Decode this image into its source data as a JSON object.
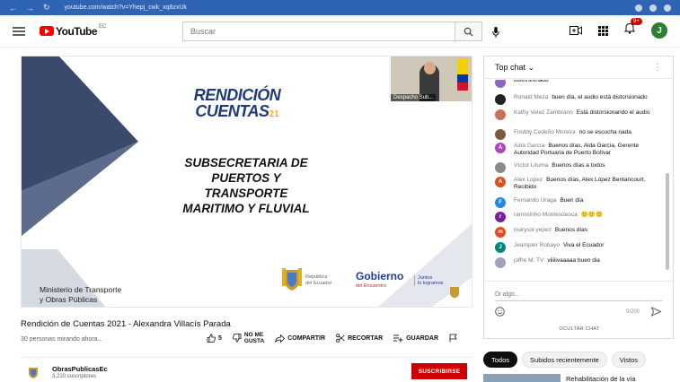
{
  "browser": {
    "url": "youtube.com/watch?v=Yhepj_cwk_xq8zxUk"
  },
  "header": {
    "logo_text": "YouTube",
    "country": "EC",
    "search_placeholder": "Buscar",
    "notification_count": "9+",
    "avatar_letter": "J",
    "colors": {
      "logo_red": "#ff0000",
      "avatar_bg": "#2e7d32"
    }
  },
  "video": {
    "rendicion_top": "RENDICIÓN",
    "rendicion_bottom": "CUENTAS",
    "rendicion_year": "21",
    "subtitle_lines": [
      "SUBSECRETARIA DE",
      "PUERTOS Y",
      "TRANSPORTE",
      "MARITIMO Y FLUVIAL"
    ],
    "ministerio_lines": [
      "Ministerio de Transporte",
      "y Obras Públicas"
    ],
    "pip_label": "Despacho Sub...",
    "republica_lines": [
      "República",
      "del Ecuador"
    ],
    "gobierno": "Gobierno",
    "gobierno_sub": "del Encuentro",
    "juntos_lines": [
      "Juntos",
      "lo logramos"
    ]
  },
  "below": {
    "title": "Rendición de Cuentas 2021 - Alexandra Villacís Parada",
    "viewers": "30 personas mirando ahora...",
    "like_count": "5",
    "dislike_label_1": "NO ME",
    "dislike_label_2": "GUSTA",
    "share_label": "COMPARTIR",
    "clip_label": "RECORTAR",
    "save_label": "GUARDAR"
  },
  "channel": {
    "name": "ObrasPublicasEc",
    "subscribers": "3,210 suscriptores",
    "subscribe_label": "SUSCRIBIRSE"
  },
  "chat": {
    "title": "Top chat",
    "messages": [
      {
        "author": "",
        "text": "distorsionado",
        "color": "#8e63c9",
        "initial": ""
      },
      {
        "author": "Ronald Meza",
        "text": "buen día, el audio está distorsionado",
        "color": "#222222",
        "initial": ""
      },
      {
        "author": "Kathy Velez Zambrano",
        "text": "Está distorsionando el audio",
        "color": "#c8705a",
        "initial": ""
      },
      {
        "author": "Freddy Cedeño Moreira",
        "text": "no se escucha nada",
        "color": "#7a5a3a",
        "initial": ""
      },
      {
        "author": "Aida García",
        "text": "Buenos días, Aida García, Gerente Autoridad Portuaria de Puerto Bolívar",
        "color": "#ab47bc",
        "initial": "A"
      },
      {
        "author": "Víctor Lituma",
        "text": "Buenos días a todos",
        "color": "#8a8a8a",
        "initial": ""
      },
      {
        "author": "Alex Lopez",
        "text": "Buenos días, Alex López Bentancourt, Recibido",
        "color": "#d9531e",
        "initial": "A"
      },
      {
        "author": "Fernando Uraga",
        "text": "Buen día",
        "color": "#1e88e5",
        "initial": "F"
      },
      {
        "author": "raminiinho Montesdeoca",
        "text": "🙂🙂🙂",
        "color": "#7b1fa2",
        "initial": "r"
      },
      {
        "author": "marysol yepez",
        "text": "Buenos días",
        "color": "#e64a19",
        "initial": "m"
      },
      {
        "author": "Jeampier Robayo",
        "text": "Viva el Ecuador",
        "color": "#00897b",
        "initial": "J"
      },
      {
        "author": "joffre M. TV",
        "text": "viiiiivaaaaa buen dia",
        "color": "#a0a0c0",
        "initial": ""
      }
    ],
    "input_placeholder": "Di algo...",
    "char_count": "0/200",
    "hide_label": "OCULTAR CHAT"
  },
  "chips": [
    "Todos",
    "Subidos recientemente",
    "Vistos"
  ],
  "next_video_title": "Rehabilitación de la vía"
}
